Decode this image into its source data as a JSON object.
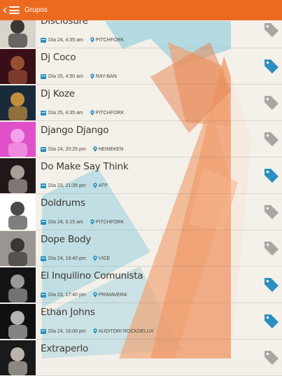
{
  "header": {
    "title": "Grupos",
    "back_icon": "chevron-left-icon",
    "menu_icon": "hamburger-menu-icon",
    "color": "#ec6a1f"
  },
  "rows": [
    {
      "name": "Disclosure",
      "date": "Día 24, 4:35 am",
      "stage": "PITCHFORK",
      "favorite": false,
      "thumb": [
        "#d8d4cc",
        "#1e1b1a"
      ]
    },
    {
      "name": "Dj Coco",
      "date": "Día 25, 4:50 am",
      "stage": "RAY-BAN",
      "favorite": true,
      "thumb": [
        "#3a0e16",
        "#a85a3a"
      ]
    },
    {
      "name": "Dj Koze",
      "date": "Día 25, 4:35 am",
      "stage": "PITCHFORK",
      "favorite": false,
      "thumb": [
        "#1a2a3a",
        "#e0a040"
      ]
    },
    {
      "name": "Django Django",
      "date": "Día 24, 20:25 pm",
      "stage": "HEINEKEN",
      "favorite": false,
      "thumb": [
        "#e050c8",
        "#f6b0ee"
      ]
    },
    {
      "name": "Do Make Say Think",
      "date": "Día 23, 21:35 pm",
      "stage": "ATP",
      "favorite": true,
      "thumb": [
        "#201818",
        "#c0b8b0"
      ]
    },
    {
      "name": "Doldrums",
      "date": "Día 24, 0:15 am",
      "stage": "PITCHFORK",
      "favorite": false,
      "thumb": [
        "#ffffff",
        "#2a2a2a"
      ]
    },
    {
      "name": "Dope Body",
      "date": "Día 24, 19:40 pm",
      "stage": "VICE",
      "favorite": false,
      "thumb": [
        "#9a9590",
        "#2a2622"
      ]
    },
    {
      "name": "El Inquilino Comunista",
      "date": "Día 23, 17:40 pm",
      "stage": "PRIMAVERA",
      "favorite": true,
      "thumb": [
        "#141414",
        "#b0b0b0"
      ]
    },
    {
      "name": "Ethan Johns",
      "date": "Día 24, 16:00 pm",
      "stage": "AUDITORI ROCKDELUX",
      "favorite": true,
      "thumb": [
        "#101010",
        "#d0d0d0"
      ]
    },
    {
      "name": "Extraperlo",
      "date": "",
      "stage": "",
      "favorite": false,
      "thumb": [
        "#1a1a1a",
        "#d8d0c8"
      ]
    }
  ],
  "colors": {
    "favorite_tag": "#2b8fbf",
    "default_tag": "#a8a6a3",
    "accent_orange": "#ec6a1f",
    "accent_blue": "#7ecbd9"
  },
  "icons": {
    "date": "calendar-icon",
    "stage": "location-pin-icon",
    "favorite": "tag-icon"
  }
}
